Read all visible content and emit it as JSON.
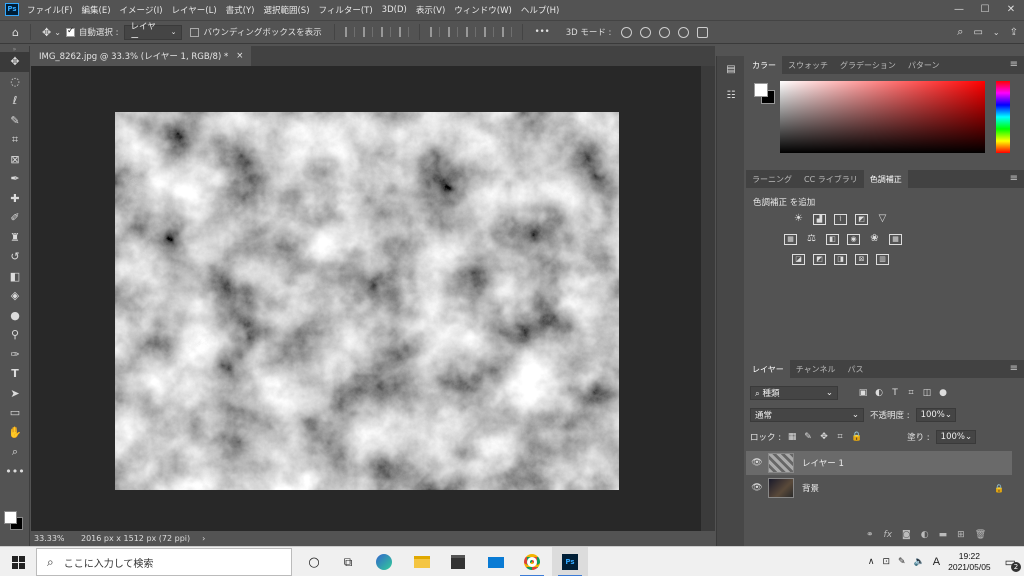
{
  "app": {
    "logo": "Ps"
  },
  "menu": [
    "ファイル(F)",
    "編集(E)",
    "イメージ(I)",
    "レイヤー(L)",
    "書式(Y)",
    "選択範囲(S)",
    "フィルター(T)",
    "3D(D)",
    "表示(V)",
    "ウィンドウ(W)",
    "ヘルプ(H)"
  ],
  "window_controls": {
    "minimize": "—",
    "maximize": "☐",
    "close": "✕"
  },
  "options": {
    "auto_select_label": "自動選択 :",
    "auto_select_checked": true,
    "auto_select_target": "レイヤー",
    "bounding_box_label": "バウンディングボックスを表示",
    "bounding_box_checked": false,
    "more": "•••",
    "mode3d_label": "3D モード :"
  },
  "document": {
    "tab_title": "IMG_8262.jpg @ 33.3% (レイヤー 1, RGB/8) *",
    "tab_close": "×",
    "zoom": "33.33%",
    "dimensions": "2016 px x 1512 px (72 ppi)",
    "status_arrow": "›"
  },
  "panels": {
    "color_tabs": [
      "カラー",
      "スウォッチ",
      "グラデーション",
      "パターン"
    ],
    "adj_tabs": [
      "ラーニング",
      "CC ライブラリ",
      "色調補正"
    ],
    "adj_title": "色調補正 を追加",
    "layers_tabs": [
      "レイヤー",
      "チャンネル",
      "パス"
    ],
    "filter_kind": "種類",
    "blend_mode": "通常",
    "opacity_label": "不透明度 :",
    "opacity_value": "100%",
    "lock_label": "ロック :",
    "fill_label": "塗り :",
    "fill_value": "100%",
    "layers": [
      {
        "name": "レイヤー 1",
        "selected": true,
        "locked": false
      },
      {
        "name": "背景",
        "selected": false,
        "locked": true
      }
    ]
  },
  "taskbar": {
    "search_placeholder": "ここに入力して検索",
    "ime": "A",
    "time": "19:22",
    "date": "2021/05/05",
    "notification_count": "2"
  }
}
